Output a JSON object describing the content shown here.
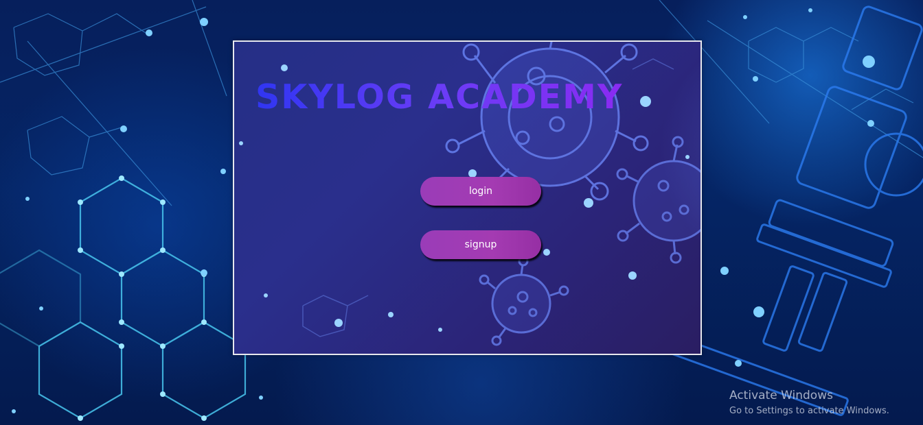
{
  "app": {
    "title": "SKYLOG ACADEMY"
  },
  "actions": {
    "login_label": "login",
    "signup_label": "signup"
  },
  "os_watermark": {
    "title": "Activate Windows",
    "subtitle": "Go to Settings to activate Windows."
  },
  "background": {
    "imagery": [
      "hexagon-network",
      "molecule-structures",
      "virus-particles",
      "microscope"
    ],
    "colors": {
      "base": "#052565",
      "glow": "#1e8cff",
      "card": "#2a2f8c",
      "button": "#a43bb2",
      "title_start": "#3036f2",
      "title_end": "#8a2bf2"
    }
  }
}
